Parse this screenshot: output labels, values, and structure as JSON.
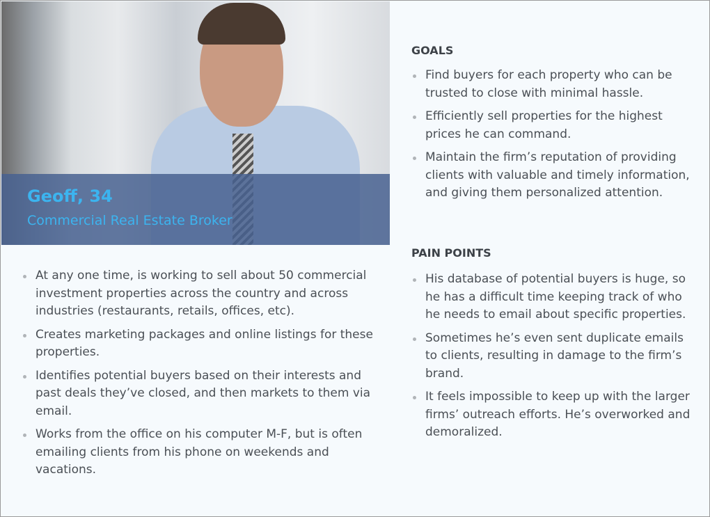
{
  "persona": {
    "name": "Geoff, 34",
    "role": "Commercial Real Estate Broker"
  },
  "about": [
    "At any one time, is working to sell about 50 commercial investment properties across the country and across industries (restaurants, retails, offices, etc).",
    "Creates marketing packages and online listings for these properties.",
    "Identifies potential buyers based on their interests and past deals they’ve closed, and then markets to them via email.",
    "Works from the office on his computer M-F, but is often emailing clients from his phone on weekends and vacations."
  ],
  "goals": {
    "title": "GOALS",
    "items": [
      "Find buyers for each property who can be trusted to close with minimal hassle.",
      "Efficiently sell properties for the highest prices he can command.",
      "Maintain the firm’s reputation of providing clients with valuable and timely information, and giving them personalized attention."
    ]
  },
  "pain_points": {
    "title": "PAIN POINTS",
    "items": [
      "His database of potential buyers is huge, so he has a difficult time keeping track of who he needs to email about specific properties.",
      "Sometimes he’s even sent duplicate emails to clients, resulting in damage to the firm’s brand.",
      "It feels impossible to keep up with the larger firms’ outreach efforts. He’s overworked and demoralized."
    ]
  },
  "colors": {
    "accent": "#3cb4ef",
    "overlay": "#486291"
  }
}
